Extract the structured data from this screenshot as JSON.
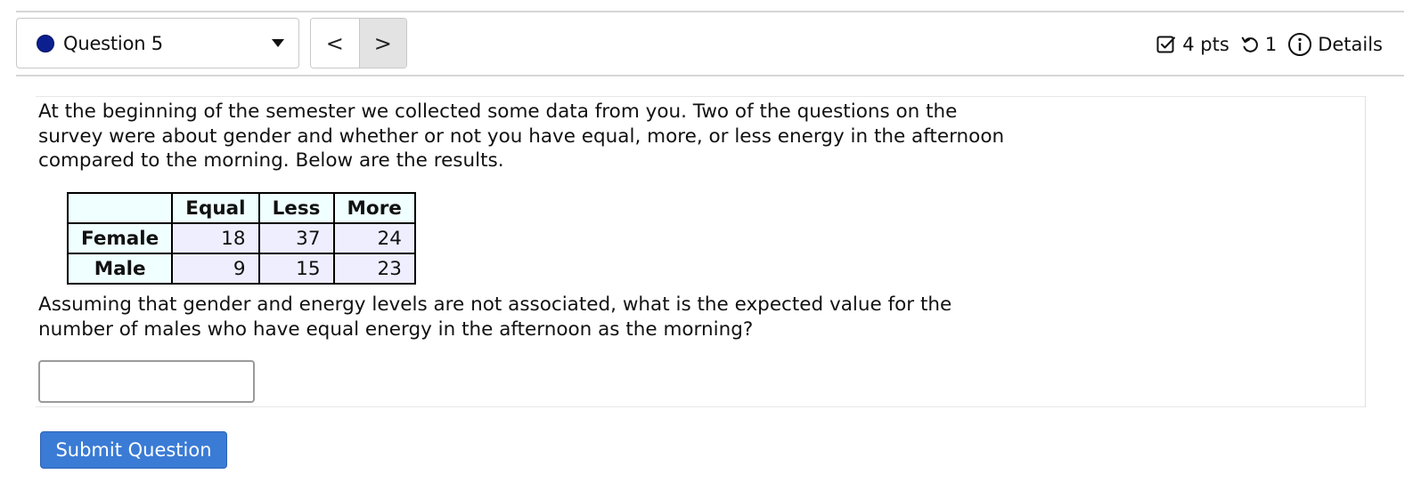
{
  "header": {
    "question_label": "Question 5",
    "status_color": "#0b1f8f",
    "prev_symbol": "<",
    "next_symbol": ">",
    "points": "4 pts",
    "attempts": "1",
    "details_label": "Details",
    "icons": {
      "points": "checkbox-edit-icon",
      "attempts": "undo-icon",
      "details": "info-icon",
      "select": "caret-down-icon"
    }
  },
  "question": {
    "intro": "At the beginning of the semester we collected some data from you. Two of the questions on the survey were about gender and whether or not you have equal, more, or less energy in the afternoon compared to the morning. Below are the results.",
    "prompt": "Assuming that gender and energy levels are not associated, what is the expected value for the number of males who have equal energy in the afternoon as the morning?",
    "table": {
      "columns": [
        "Equal",
        "Less",
        "More"
      ],
      "rows": [
        {
          "label": "Female",
          "values": [
            "18",
            "37",
            "24"
          ]
        },
        {
          "label": "Male",
          "values": [
            "9",
            "15",
            "23"
          ]
        }
      ],
      "header_bg": "#f0ffff",
      "cell_bg": "#eeeeff"
    },
    "answer_value": "",
    "submit_label": "Submit Question",
    "submit_color": "#3a7bd5"
  }
}
